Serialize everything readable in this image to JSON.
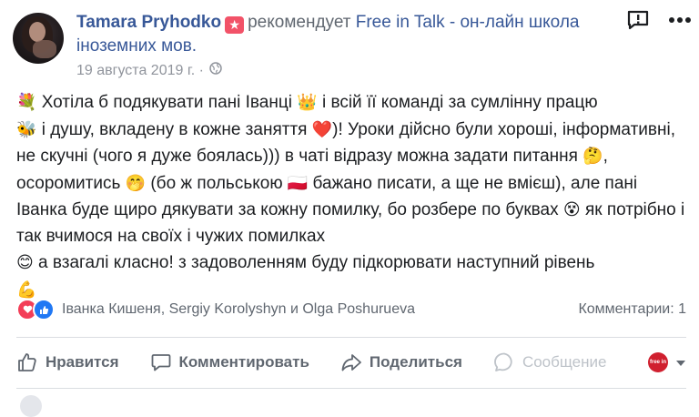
{
  "post": {
    "author": "Tamara Pryhodko",
    "recommend_text": "рекомендует",
    "page_name": "Free in Talk - он-лайн школа іноземних мов.",
    "date": "19 августа 2019 г. ·",
    "body": {
      "seg1": " Хотіла б подякувати пані Іванці ",
      "seg2": " і всій її команді за сумлінну працю",
      "seg3": " і душу, вкладену в кожне заняття ",
      "seg4": ")! Уроки дійсно були хороші, інформативні, не скучні (чого я дуже боялась))) в чаті відразу можна задати питання ",
      "seg5": ", осоромитись ",
      "seg6": " (бо ж польською ",
      "seg7": " бажано писати, а ще не вмієш), але пані Іванка буде щиро дякувати за кожну помилку, бо розбере по буквах ",
      "seg8": " як потрібно і так вчимося на своїх і чужих помилках",
      "seg9": " а взагалі класно! з задоволенням буду підкорювати наступний рівень",
      "emoji": {
        "flower": "💐",
        "crown": "👑",
        "bee": "🐝",
        "heart": "❤️",
        "thinking": "🤔",
        "shy": "🤭",
        "flag": "🇵🇱",
        "dizzy": "😵",
        "smile": "😊",
        "muscle": "💪"
      }
    }
  },
  "reactions": {
    "names": "Іванка Кишеня, Sergiy Korolyshyn и Olga Poshurueva",
    "comments": "Комментарии: 1"
  },
  "actions": {
    "like": "Нравится",
    "comment": "Комментировать",
    "share": "Поделиться",
    "message": "Сообщение"
  },
  "page_avatar_text": "free in talk",
  "colors": {
    "link": "#385898",
    "muted": "#606770",
    "badge": "#f25268",
    "love": "#f33e58",
    "like": "#2078f4"
  }
}
